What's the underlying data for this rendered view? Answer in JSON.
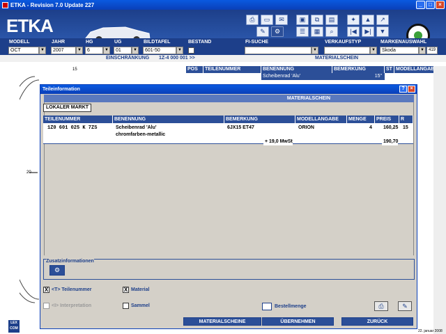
{
  "window": {
    "title": "ETKA - Revision 7.0 Update 227"
  },
  "banner": {
    "logo": "ETKA"
  },
  "selection": {
    "modell": {
      "label": "MODELL",
      "value": "OCT"
    },
    "jahr": {
      "label": "JAHR",
      "value": "2007"
    },
    "hg": {
      "label": "HG",
      "value": "6"
    },
    "ug": {
      "label": "UG",
      "value": "01"
    },
    "bildtafel": {
      "label": "BILDTAFEL",
      "value": "601-50"
    },
    "bestand": {
      "label": "BESTAND"
    },
    "fisuche": {
      "label": "FI-SUCHE",
      "value": ""
    },
    "verkaufstyp": {
      "label": "VERKAUFSTYP",
      "value": ""
    },
    "markenauswahl": {
      "label": "MARKENAUSWAHL",
      "value": "Skoda",
      "count": "419"
    }
  },
  "inforow": {
    "einschraenkung": "EINSCHRÄNKUNG",
    "range": "1Z-4 000 001 >>",
    "material": "MATERIALSCHEIN"
  },
  "background_table": {
    "headers": [
      "POS",
      "TEILENUMMER",
      "BENENNUNG",
      "BEMERKUNG",
      "ST",
      "MODELLANGABE"
    ],
    "row": {
      "benennung": "Scheibenrad 'Alu'",
      "st": "15\""
    }
  },
  "diagram": {
    "label_top": "15",
    "label_left": "20"
  },
  "footer": {
    "lexcom": "LEX COM",
    "date": "22. januar 2008"
  },
  "dialog": {
    "title": "Teileinformation",
    "bar": "MATERIALSCHEIN",
    "lokaler_markt": "LOKALER MARKT",
    "headers": [
      "TEILENUMMER",
      "BENENNUNG",
      "BEMERKUNG",
      "MODELLANGABE",
      "MENGE",
      "PREIS",
      "R"
    ],
    "row": {
      "teilenummer": "1Z0 601 025 K  7ZS",
      "benennung_1": "Scheibenrad 'Alu'",
      "benennung_2": "chromfarben-metallic",
      "bemerkung": "6JX15 ET47",
      "modellangabe": "ORION",
      "menge": "4",
      "preis": "160,25",
      "r": "15",
      "mwst_label": "+ 19,0 MwSt",
      "mwst_value": "190,70"
    },
    "zusatz_label": "Zusatzinformationen",
    "checkboxes": {
      "teilenummer": {
        "label": "<T> Teilenummer",
        "checked": "X"
      },
      "material": {
        "label": "Material",
        "checked": "X"
      },
      "interpretation": {
        "label": "<I> Interpretation"
      },
      "sammel": {
        "label": "Sammel"
      }
    },
    "bestellmenge": "Bestellmenge",
    "buttons": {
      "materialscheine": "MATERIALSCHEINE",
      "uebernehmen": "ÜBERNEHMEN",
      "zurueck": "ZURÜCK"
    }
  },
  "colors": {
    "navy": "#1d3f8a",
    "titlebar": "#0a5ae0",
    "header": "#2c4f98"
  }
}
